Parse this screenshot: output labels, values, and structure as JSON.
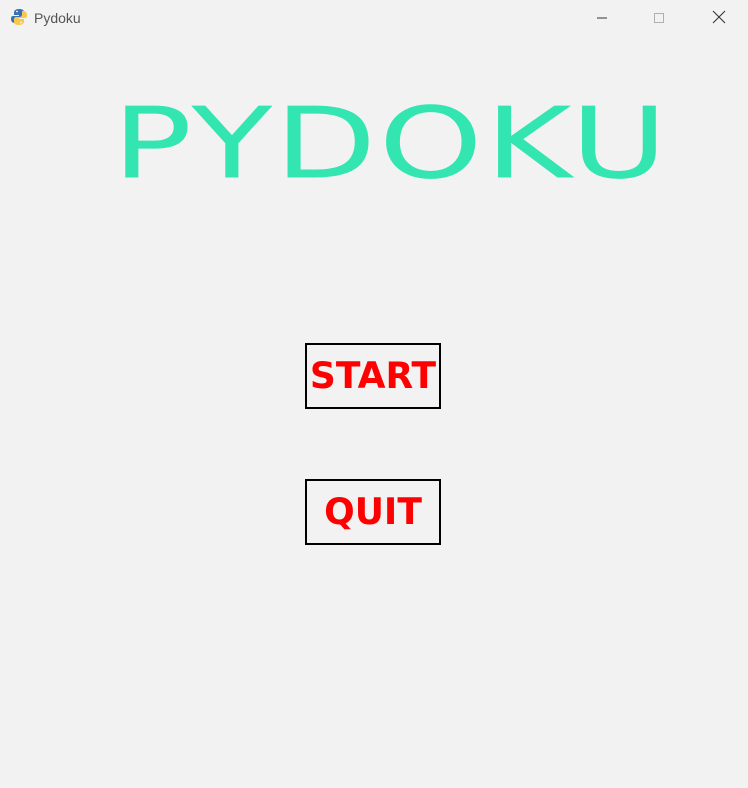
{
  "window": {
    "title": "Pydoku",
    "app_icon": "python-snake-icon",
    "controls": {
      "minimize": "minimize-icon",
      "maximize": "maximize-icon",
      "close": "close-icon"
    }
  },
  "game": {
    "title": "PYDOKU",
    "title_color": "#33e5b0",
    "buttons": {
      "start_label": "START",
      "quit_label": "QUIT",
      "label_color": "#ff0000",
      "border_color": "#000000"
    }
  },
  "colors": {
    "background": "#f2f2f2"
  }
}
